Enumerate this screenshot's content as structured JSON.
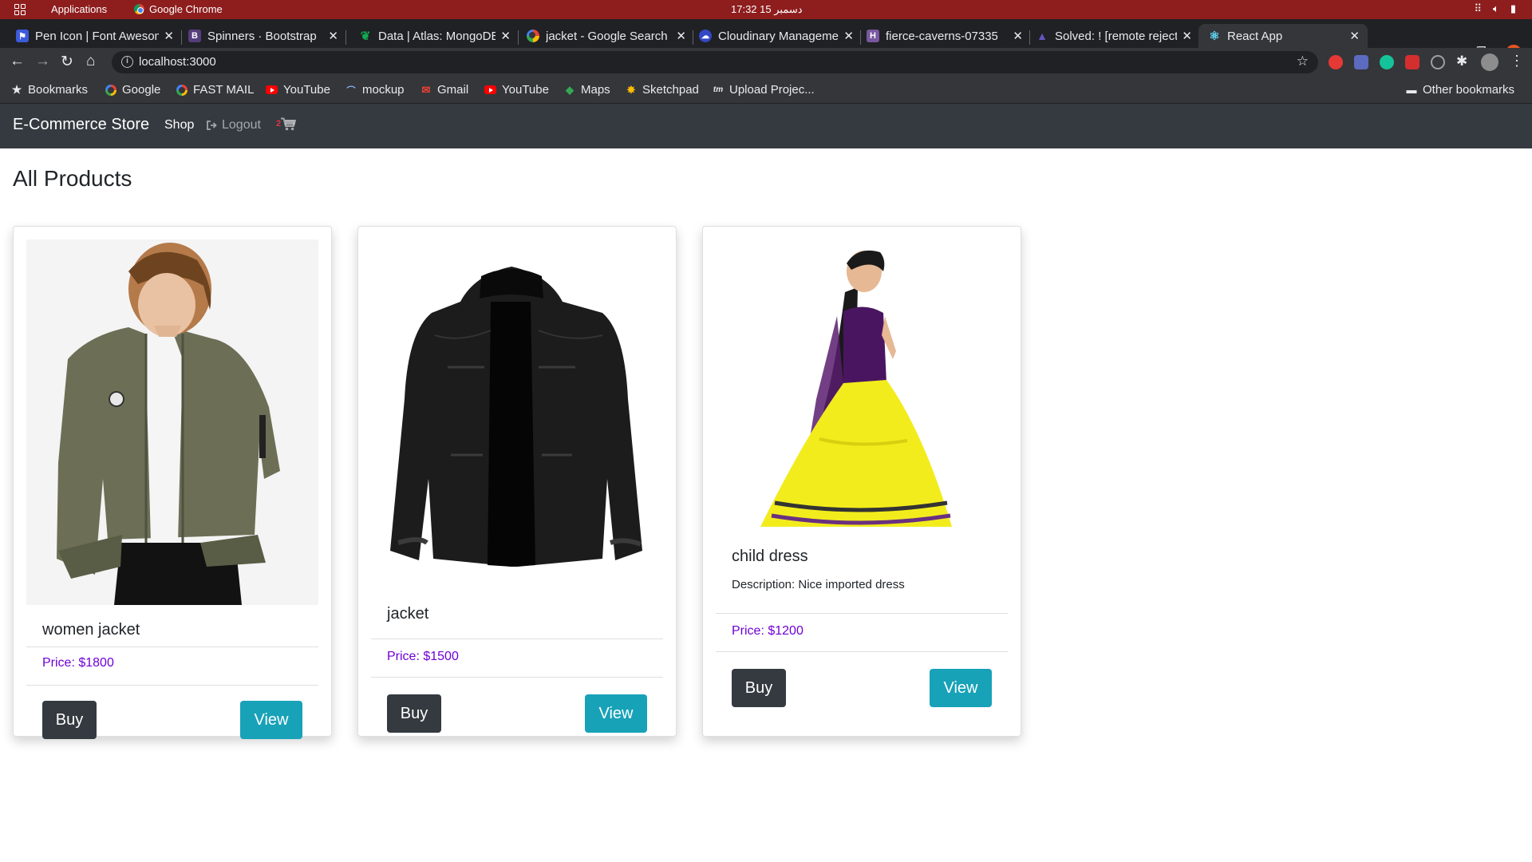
{
  "os": {
    "apps_label": "Applications",
    "app_name": "Google Chrome",
    "clock": "17:32  15 دسمبر"
  },
  "tabs": [
    {
      "title": "Pen Icon | Font Awesome",
      "icon": "font-awesome-flag-icon"
    },
    {
      "title": "Spinners · Bootstrap",
      "icon": "bootstrap-icon"
    },
    {
      "title": "Data | Atlas: MongoDB",
      "icon": "mongodb-leaf-icon"
    },
    {
      "title": "jacket - Google Search",
      "icon": "google-icon"
    },
    {
      "title": "Cloudinary Management",
      "icon": "cloudinary-cloud-icon"
    },
    {
      "title": "fierce-caverns-07335",
      "icon": "heroku-icon"
    },
    {
      "title": "Solved: ! [remote rejected]",
      "icon": "atlassian-icon"
    },
    {
      "title": "React App",
      "icon": "react-icon"
    }
  ],
  "address": {
    "url": "localhost:3000"
  },
  "bookmarks": {
    "label": "Bookmarks",
    "items": [
      {
        "label": "Google",
        "icon": "google-icon"
      },
      {
        "label": "FAST MAIL",
        "icon": "google-icon"
      },
      {
        "label": "YouTube",
        "icon": "youtube-icon"
      },
      {
        "label": "mockup",
        "icon": "mockup-icon"
      },
      {
        "label": "Gmail",
        "icon": "gmail-icon"
      },
      {
        "label": "YouTube",
        "icon": "youtube-icon"
      },
      {
        "label": "Maps",
        "icon": "maps-icon"
      },
      {
        "label": "Sketchpad",
        "icon": "sketchpad-icon"
      },
      {
        "label": "Upload Projec...",
        "icon": "tm-icon"
      }
    ],
    "other": "Other bookmarks"
  },
  "app": {
    "brand": "E-Commerce Store",
    "nav_shop": "Shop",
    "nav_logout": "Logout",
    "cart_count": "2",
    "page_title": "All Products"
  },
  "products": [
    {
      "name": "women jacket",
      "description": "",
      "price": "Price: $1800",
      "buy": "Buy",
      "view": "View"
    },
    {
      "name": "jacket",
      "description": "",
      "price": "Price: $1500",
      "buy": "Buy",
      "view": "View"
    },
    {
      "name": "child dress",
      "description": "Description: Nice imported dress",
      "price": "Price: $1200",
      "buy": "Buy",
      "view": "View"
    }
  ],
  "colors": {
    "os_bar": "#8e1d1d",
    "navbar": "#343a40",
    "price": "#6f00d6",
    "buy_button": "#343a40",
    "view_button": "#17a2b8"
  }
}
